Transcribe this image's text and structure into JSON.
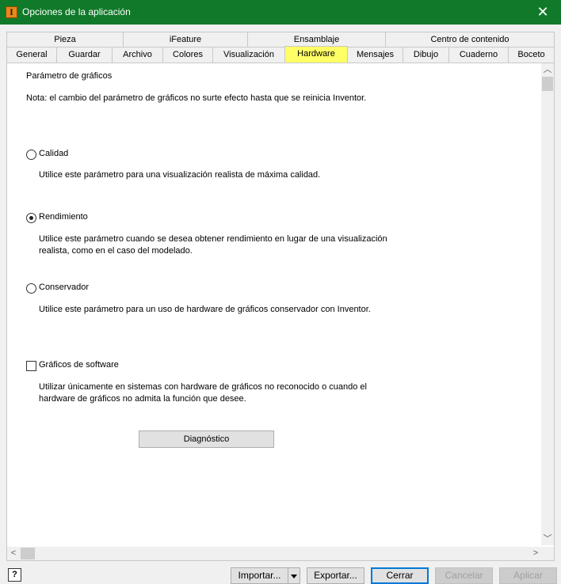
{
  "window": {
    "title": "Opciones de la aplicación",
    "close_glyph": "✕"
  },
  "tabs_row1": [
    {
      "label": "Pieza"
    },
    {
      "label": "iFeature"
    },
    {
      "label": "Ensamblaje"
    },
    {
      "label": "Centro de contenido"
    }
  ],
  "tabs_row2": [
    {
      "label": "General"
    },
    {
      "label": "Guardar"
    },
    {
      "label": "Archivo"
    },
    {
      "label": "Colores"
    },
    {
      "label": "Visualización"
    },
    {
      "label": "Hardware"
    },
    {
      "label": "Mensajes"
    },
    {
      "label": "Dibujo"
    },
    {
      "label": "Cuaderno"
    },
    {
      "label": "Boceto"
    }
  ],
  "active_tab": "Hardware",
  "hardware": {
    "section_title": "Parámetro de gráficos",
    "note": "Nota: el cambio del parámetro de gráficos no surte efecto hasta que se reinicia Inventor.",
    "options": [
      {
        "label": "Calidad",
        "checked": false,
        "description": "Utilice este parámetro para una visualización realista de máxima calidad."
      },
      {
        "label": "Rendimiento",
        "checked": true,
        "description": "Utilice este parámetro cuando se desea obtener rendimiento en lugar de una visualización realista, como en el caso del modelado."
      },
      {
        "label": "Conservador",
        "checked": false,
        "description": "Utilice este parámetro para un uso de hardware de gráficos conservador con Inventor."
      }
    ],
    "software_graphics": {
      "label": "Gráficos de software",
      "checked": false,
      "description": "Utilizar únicamente en sistemas con hardware de gráficos no reconocido o cuando el hardware de gráficos no admita la función que desee."
    },
    "diagnostic_button": "Diagnóstico"
  },
  "footer": {
    "help": "?",
    "import": "Importar...",
    "export": "Exportar...",
    "close": "Cerrar",
    "cancel": "Cancelar",
    "apply": "Aplicar"
  },
  "scroll_glyphs": {
    "up": "︿",
    "down": "﹀",
    "left": "<",
    "right": ">"
  },
  "colors": {
    "titlebar": "#117a2a",
    "active_tab": "#ffff66",
    "default_button_border": "#0078d7"
  }
}
